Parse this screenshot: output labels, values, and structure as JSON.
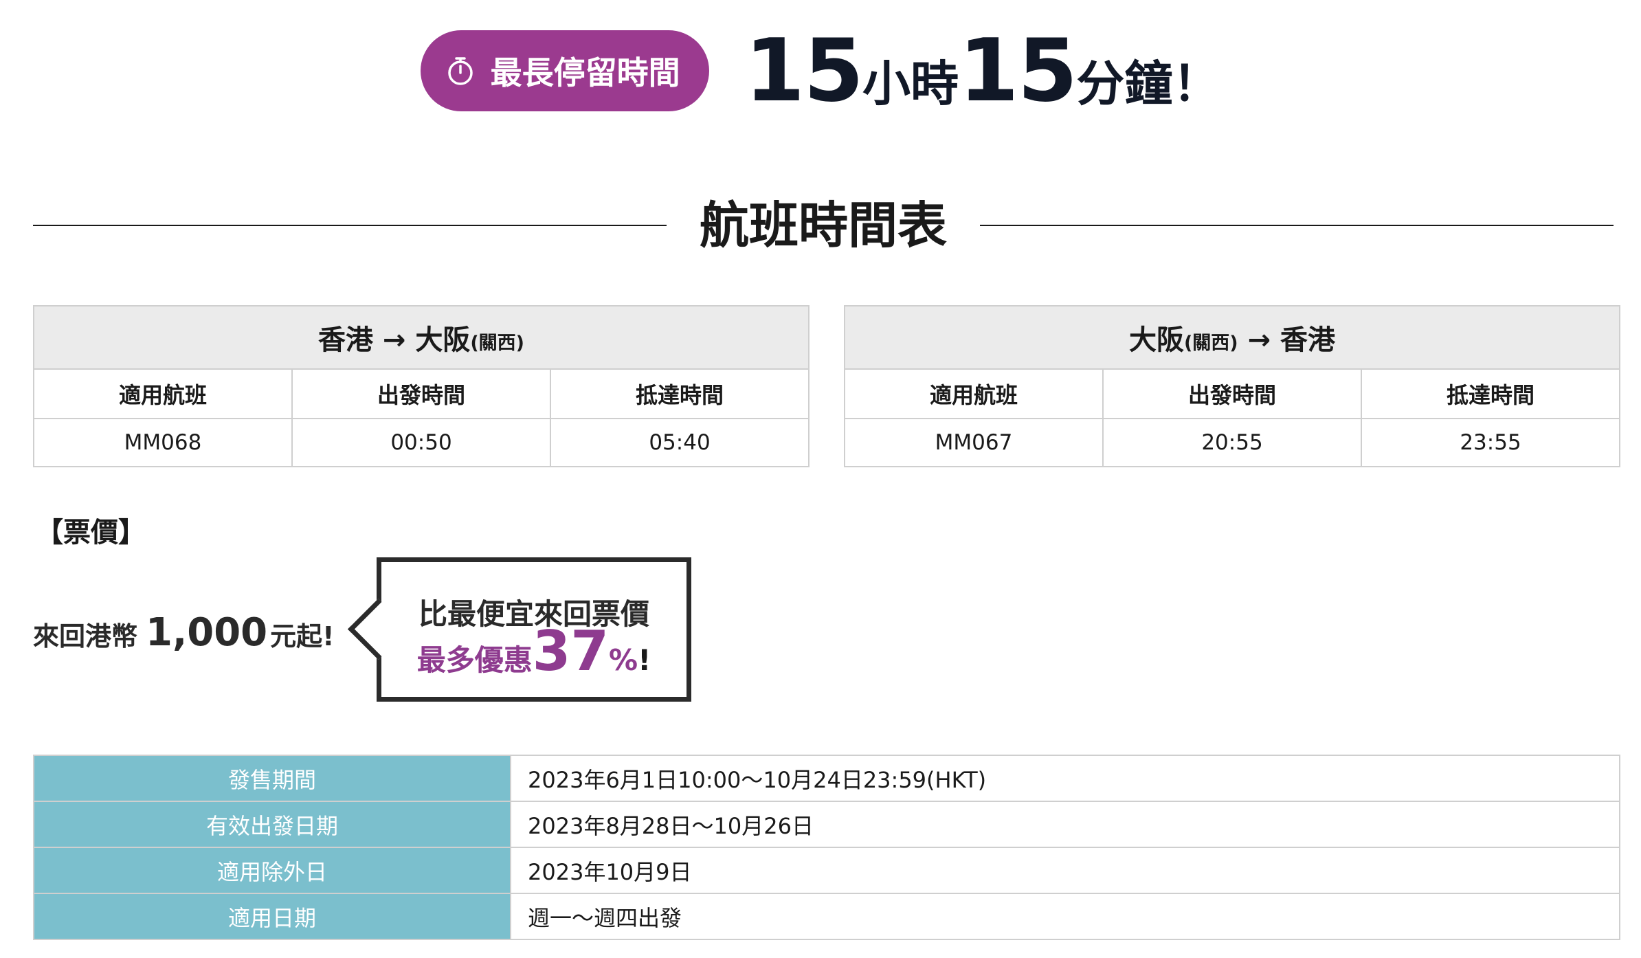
{
  "hero": {
    "badge_label": "最長停留時間",
    "hours": "15",
    "hours_unit": "小時",
    "minutes": "15",
    "minutes_unit": "分鐘！"
  },
  "section_title": "航班時間表",
  "schedule": [
    {
      "route_from": "香港",
      "arrow": "→",
      "route_to": "大阪",
      "route_to_note": "(關西)",
      "headers": [
        "適用航班",
        "出發時間",
        "抵達時間"
      ],
      "row": [
        "MM068",
        "00:50",
        "05:40"
      ]
    },
    {
      "route_from": "大阪",
      "route_from_note": "(關西)",
      "arrow": "→",
      "route_to": "香港",
      "headers": [
        "適用航班",
        "出發時間",
        "抵達時間"
      ],
      "row": [
        "MM067",
        "20:55",
        "23:55"
      ]
    }
  ],
  "fare": {
    "heading": "【票價】",
    "prefix": "來回港幣",
    "amount": "1,000",
    "suffix": "元起!",
    "bubble_line1": "比最便宜來回票價",
    "bubble_label": "最多優惠",
    "discount": "37",
    "percent_sign": "%",
    "exclaim": "!"
  },
  "info": [
    {
      "label": "發售期間",
      "value": "2023年6月1日10:00～10月24日23:59(HKT)"
    },
    {
      "label": "有效出發日期",
      "value": "2023年8月28日～10月26日"
    },
    {
      "label": "適用除外日",
      "value": "2023年10月9日"
    },
    {
      "label": "適用日期",
      "value": "週一～週四出發"
    }
  ],
  "colors": {
    "brand_purple": "#9b3a8f",
    "discount_purple": "#8e3b8f",
    "info_label_bg": "#7bbfcd",
    "route_header_bg": "#ebebeb"
  },
  "icons": {
    "badge": "stopwatch-icon"
  }
}
